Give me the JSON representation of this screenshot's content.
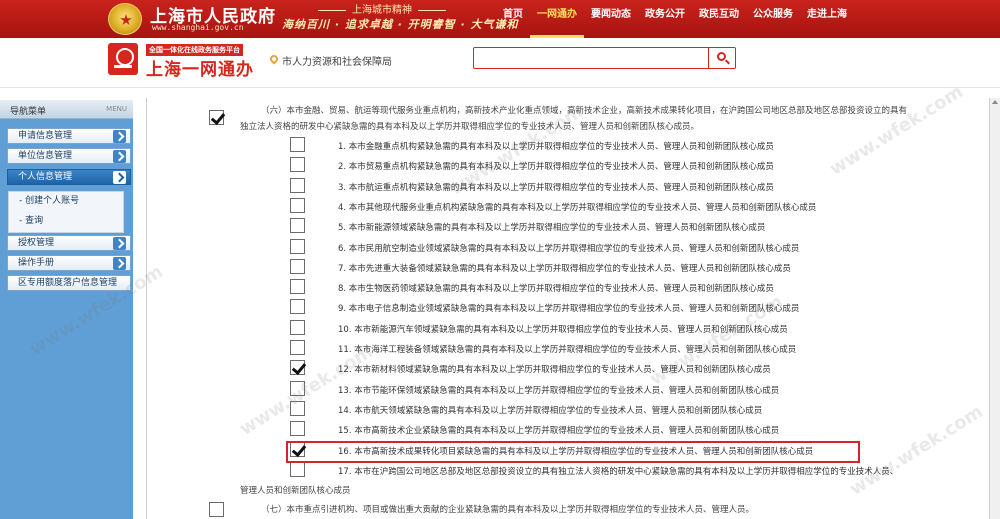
{
  "header": {
    "site_title": "上海市人民政府",
    "site_url": "www.shanghai.gov.cn",
    "spirit_title": "上海城市精神",
    "spirit_text": "海纳百川 · 追求卓越 · 开明睿智 · 大气谦和",
    "nav": [
      "首页",
      "一网通办",
      "要闻动态",
      "政务公开",
      "政民互动",
      "公众服务",
      "走进上海"
    ],
    "active_nav": "一网通办",
    "accent_color": "#c8231d"
  },
  "subheader": {
    "platform_tag": "全国一体化在线政务服务平台",
    "platform_name": "上海一网通办",
    "location": "市人力资源和社会保障局",
    "search_placeholder": ""
  },
  "sidebar": {
    "title": "导航菜单",
    "menu_label": "MENU",
    "items": [
      "申请信息管理",
      "单位信息管理",
      "个人信息管理",
      "授权管理",
      "操作手册",
      "区专用额度落户信息管理"
    ],
    "active_item": "个人信息管理",
    "subitems": [
      "创建个人账号",
      "查询"
    ]
  },
  "content": {
    "section_six_line1": "（六）本市金融、贸易、航运等现代服务业重点机构，高新技术产业化重点领域，高新技术企业，高新技术成果转化项目，在沪跨国公司地区总部及地区总部投资设立的具有",
    "section_six_line2": "独立法人资格的研发中心紧缺急需的具有本科及以上学历并取得相应学位的专业技术人员、管理人员和创新团队核心成员。",
    "items": [
      {
        "text": "1.  本市金融重点机构紧缺急需的具有本科及以上学历并取得相应学位的专业技术人员、管理人员和创新团队核心成员",
        "checked": false
      },
      {
        "text": "2.  本市贸易重点机构紧缺急需的具有本科及以上学历并取得相应学位的专业技术人员、管理人员和创新团队核心成员",
        "checked": false
      },
      {
        "text": "3.  本市航运重点机构紧缺急需的具有本科及以上学历并取得相应学位的专业技术人员、管理人员和创新团队核心成员",
        "checked": false
      },
      {
        "text": "4.  本市其他现代服务业重点机构紧缺急需的具有本科及以上学历并取得相应学位的专业技术人员、管理人员和创新团队核心成员",
        "checked": false
      },
      {
        "text": "5.  本市新能源领域紧缺急需的具有本科及以上学历并取得相应学位的专业技术人员、管理人员和创新团队核心成员",
        "checked": false
      },
      {
        "text": "6.  本市民用航空制造业领域紧缺急需的具有本科及以上学历并取得相应学位的专业技术人员、管理人员和创新团队核心成员",
        "checked": false
      },
      {
        "text": "7.  本市先进重大装备领域紧缺急需的具有本科及以上学历并取得相应学位的专业技术人员、管理人员和创新团队核心成员",
        "checked": false
      },
      {
        "text": "8.  本市生物医药领域紧缺急需的具有本科及以上学历并取得相应学位的专业技术人员、管理人员和创新团队核心成员",
        "checked": false
      },
      {
        "text": "9.  本市电子信息制造业领域紧缺急需的具有本科及以上学历并取得相应学位的专业技术人员、管理人员和创新团队核心成员",
        "checked": false
      },
      {
        "text": "10.  本市新能源汽车领域紧缺急需的具有本科及以上学历并取得相应学位的专业技术人员、管理人员和创新团队核心成员",
        "checked": false
      },
      {
        "text": "11.  本市海洋工程装备领域紧缺急需的具有本科及以上学历并取得相应学位的专业技术人员、管理人员和创新团队核心成员",
        "checked": false
      },
      {
        "text": "12.  本市新材料领域紧缺急需的具有本科及以上学历并取得相应学位的专业技术人员、管理人员和创新团队核心成员",
        "checked": true
      },
      {
        "text": "13.  本市节能环保领域紧缺急需的具有本科及以上学历并取得相应学位的专业技术人员、管理人员和创新团队核心成员",
        "checked": false
      },
      {
        "text": "14.  本市航天领域紧缺急需的具有本科及以上学历并取得相应学位的专业技术人员、管理人员和创新团队核心成员",
        "checked": false
      },
      {
        "text": "15.  本市高新技术企业紧缺急需的具有本科及以上学历并取得相应学位的专业技术人员、管理人员和创新团队核心成员",
        "checked": false
      },
      {
        "text": "16.  本市高新技术成果转化项目紧缺急需的具有本科及以上学历并取得相应学位的专业技术人员、管理人员和创新团队核心成员",
        "checked": true
      },
      {
        "text": "17.  本市在沪跨国公司地区总部及地区总部投资设立的具有独立法人资格的研发中心紧缺急需的具有本科及以上学历并取得相应学位的专业技术人员、",
        "checked": false
      }
    ],
    "item17_line2": "管理人员和创新团队核心成员",
    "section_seven": "（七）本市重点引进机构、项目或做出重大贡献的企业紧缺急需的具有本科及以上学历并取得相应学位的专业技术人员、管理人员。",
    "watermark": "www.wfek.com"
  }
}
